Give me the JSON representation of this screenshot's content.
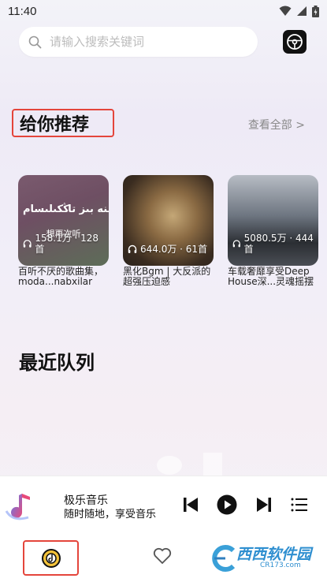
{
  "status_bar": {
    "time": "11:40",
    "icons": [
      "wifi-icon",
      "signal-icon",
      "battery-icon"
    ]
  },
  "search": {
    "placeholder": "请输入搜索关键词"
  },
  "recommend": {
    "title": "给你推荐",
    "see_all": "查看全部 >",
    "cards": [
      {
        "count": "158.1万 · 128首",
        "title": "百听不厌的歌曲集，moda...nabxilar",
        "image_text": "ئىنە بىز تاڭكىلىسام",
        "image_subtext": "想再次听"
      },
      {
        "count": "644.0万 · 61首",
        "title": "黑化Bgm | 大反派的超强压迫感",
        "image_text": "",
        "image_subtext": ""
      },
      {
        "count": "5080.5万 · 444首",
        "title": "车载奢靡享受Deep House深...灵魂摇摆",
        "image_text": "",
        "image_subtext": ""
      }
    ]
  },
  "queue": {
    "title": "最近队列"
  },
  "player": {
    "title": "极乐音乐",
    "subtitle": "随时随地，享受音乐"
  },
  "watermark": {
    "text": "西西软件园",
    "subtext": "CR173.com"
  },
  "colors": {
    "highlight_border": "#e4453b",
    "accent": "#e85d8a"
  }
}
